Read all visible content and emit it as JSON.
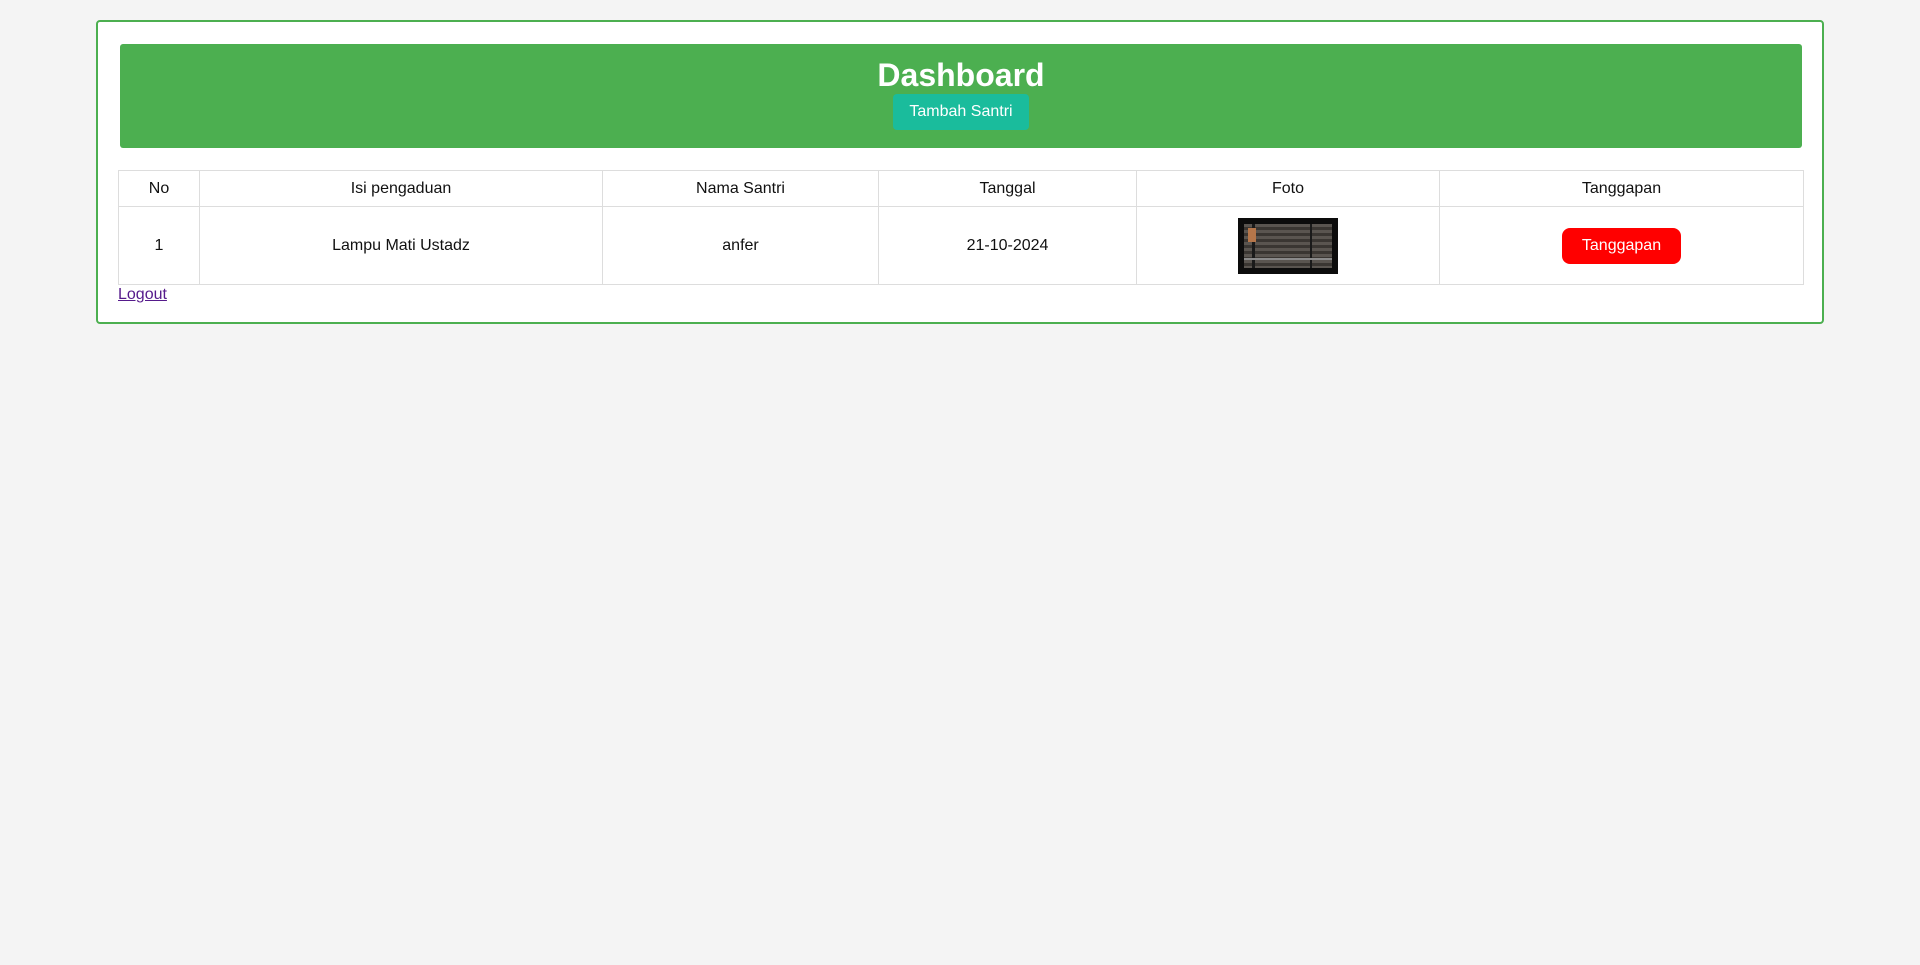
{
  "header": {
    "title": "Dashboard",
    "add_button": "Tambah Santri"
  },
  "table": {
    "columns": [
      "No",
      "Isi pengaduan",
      "Nama Santri",
      "Tanggal",
      "Foto",
      "Tanggapan"
    ],
    "rows": [
      {
        "no": "1",
        "isi": "Lampu Mati Ustadz",
        "nama": "anfer",
        "tanggal": "21-10-2024",
        "action": "Tanggapan"
      }
    ]
  },
  "logout_label": "Logout",
  "colors": {
    "header_bg": "#4caf50",
    "add_button": "#1abc9c",
    "respond_button": "#ff0000",
    "page_bg": "#f4f4f4"
  }
}
